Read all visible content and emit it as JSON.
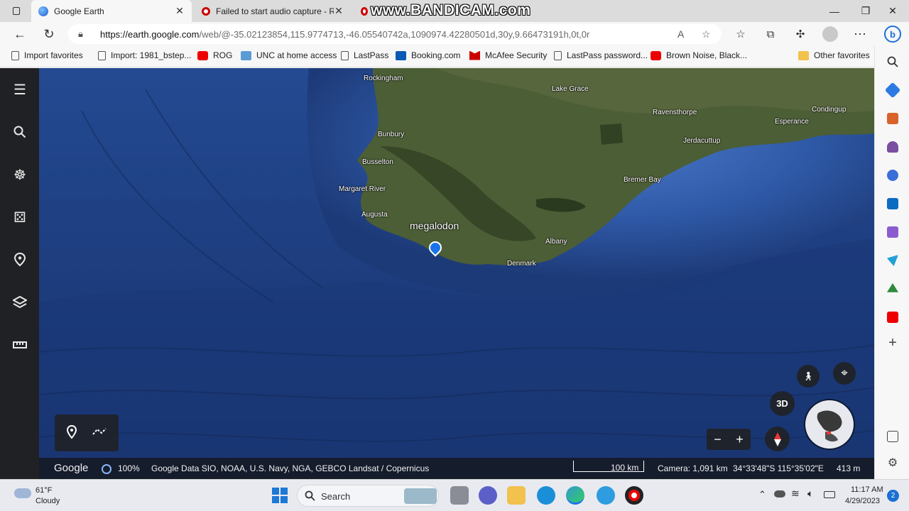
{
  "browser": {
    "tabs": [
      {
        "title": "Google Earth",
        "active": true
      },
      {
        "title": "Failed to start audio capture - Re",
        "active": false
      },
      {
        "title": "",
        "active": false
      }
    ],
    "watermark": "www.BANDICAM.com",
    "url_host": "https://earth.google.com",
    "url_path": "/web/@-35.02123854,115.9774713,-46.05540742a,1090974.42280501d,30y,9.66473191h,0t,0r",
    "favorites": [
      {
        "label": "Import favorites",
        "icon": "import-icon"
      },
      {
        "label": "Import: 1981_bstep...",
        "icon": "page-icon"
      },
      {
        "label": "ROG",
        "icon": "youtube-icon"
      },
      {
        "label": "UNC at home access",
        "icon": "unc-icon"
      },
      {
        "label": "LastPass",
        "icon": "page-icon"
      },
      {
        "label": "Booking.com",
        "icon": "booking-icon"
      },
      {
        "label": "McAfee Security",
        "icon": "mcafee-icon"
      },
      {
        "label": "LastPass password...",
        "icon": "page-icon"
      },
      {
        "label": "Brown Noise, Black...",
        "icon": "youtube-icon"
      },
      {
        "label": "Other favorites",
        "icon": "folder-icon"
      }
    ]
  },
  "map": {
    "places": [
      {
        "name": "Rockingham"
      },
      {
        "name": "Lake Grace"
      },
      {
        "name": "Ravensthorpe"
      },
      {
        "name": "Condingup"
      },
      {
        "name": "Esperance"
      },
      {
        "name": "Bunbury"
      },
      {
        "name": "Jerdacuttup"
      },
      {
        "name": "Busselton"
      },
      {
        "name": "Bremer Bay"
      },
      {
        "name": "Margaret River"
      },
      {
        "name": "Augusta"
      },
      {
        "name": "megalodon"
      },
      {
        "name": "Albany"
      },
      {
        "name": "Denmark"
      }
    ],
    "btn_3d": "3D",
    "bottom": {
      "logo": "Google",
      "load": "100%",
      "attribution": "Google   Data SIO, NOAA, U.S. Navy, NGA, GEBCO   Landsat / Copernicus",
      "scale": "100 km",
      "camera": "Camera: 1,091 km",
      "coords": "34°33'48\"S 115°35'02\"E",
      "elevation": "413 m"
    }
  },
  "taskbar": {
    "weather_temp": "61°F",
    "weather_desc": "Cloudy",
    "search_label": "Search",
    "time": "11:17 AM",
    "date": "4/29/2023",
    "notif_count": "2"
  },
  "colors": {
    "ocean": "#1f3f7a",
    "land": "#4c5e36",
    "rail": "#202124",
    "pin": "#1a73e8"
  }
}
